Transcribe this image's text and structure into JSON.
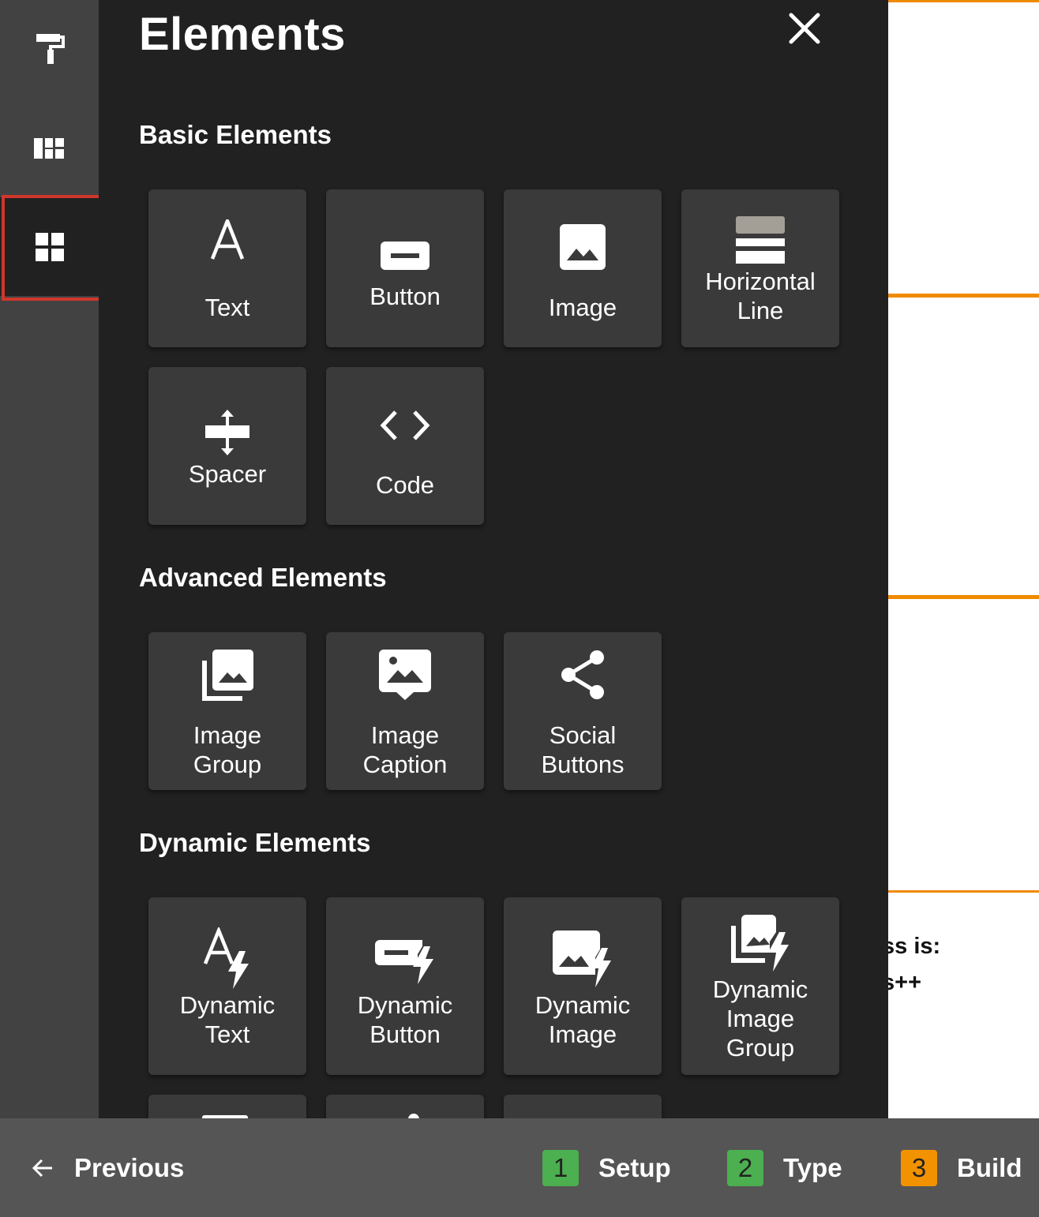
{
  "rail": {
    "items": [
      {
        "name": "style",
        "icon": "paint-roller-icon"
      },
      {
        "name": "layouts",
        "icon": "dashboard-layout-icon"
      },
      {
        "name": "elements",
        "icon": "grid-icon",
        "active": true
      }
    ]
  },
  "panel": {
    "title": "Elements",
    "close_icon": "close-icon",
    "sections": {
      "basic": {
        "title": "Basic Elements",
        "items": [
          {
            "label": "Text",
            "icon": "text-a-icon"
          },
          {
            "label": "Button",
            "icon": "button-icon"
          },
          {
            "label": "Image",
            "icon": "image-icon"
          },
          {
            "label_line1": "Horizontal",
            "label_line2": "Line",
            "icon": "horizontal-line-icon"
          },
          {
            "label": "Spacer",
            "icon": "spacer-icon"
          },
          {
            "label": "Code",
            "icon": "code-icon"
          }
        ]
      },
      "advanced": {
        "title": "Advanced Elements",
        "items": [
          {
            "label_line1": "Image",
            "label_line2": "Group",
            "icon": "image-group-icon"
          },
          {
            "label_line1": "Image",
            "label_line2": "Caption",
            "icon": "image-caption-icon"
          },
          {
            "label_line1": "Social",
            "label_line2": "Buttons",
            "icon": "share-icon"
          }
        ]
      },
      "dynamic": {
        "title": "Dynamic Elements",
        "items": [
          {
            "label_line1": "Dynamic",
            "label_line2": "Text",
            "icon": "dynamic-text-icon"
          },
          {
            "label_line1": "Dynamic",
            "label_line2": "Button",
            "icon": "dynamic-button-icon"
          },
          {
            "label_line1": "Dynamic",
            "label_line2": "Image",
            "icon": "dynamic-image-icon"
          },
          {
            "label_line1": "Dynamic",
            "label_line2": "Image",
            "label_line3": "Group",
            "icon": "dynamic-image-group-icon"
          }
        ]
      }
    }
  },
  "preview": {
    "line1": "ss is:",
    "line2": "s++",
    "accent_color": "#f08a00"
  },
  "bottombar": {
    "previous_label": "Previous",
    "previous_icon": "arrow-left-icon",
    "steps": [
      {
        "number": "1",
        "label": "Setup",
        "color": "#4caf50"
      },
      {
        "number": "2",
        "label": "Type",
        "color": "#4caf50"
      },
      {
        "number": "3",
        "label": "Build",
        "color": "#f39200"
      }
    ]
  }
}
